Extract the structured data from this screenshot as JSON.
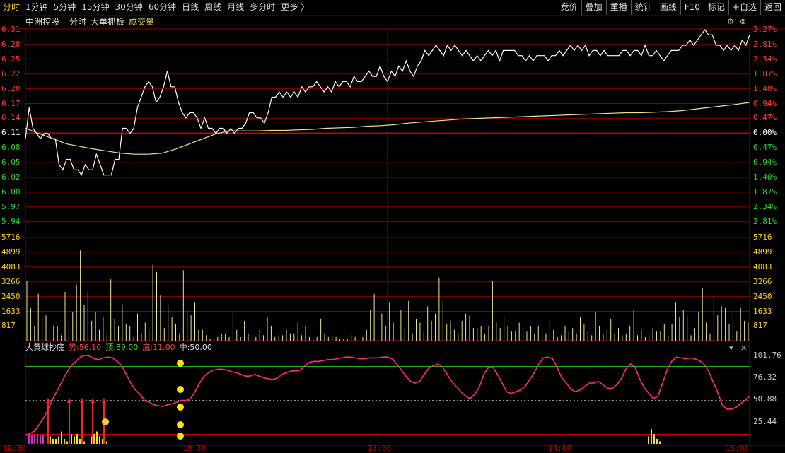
{
  "colors": {
    "background": "#000000",
    "grid": "#8b0000",
    "price_line": "#ffffff",
    "avg_line": "#e8e890",
    "up": "#ff3b3b",
    "down": "#22dd22",
    "neutral": "#ffffff",
    "volume": "#e8e890",
    "trend": "#ff2a80",
    "top_line": "#22cc22",
    "marker": "#ffe600",
    "accent": "#ffd400"
  },
  "toolbar": {
    "left_items": [
      {
        "label": "分时",
        "active": true
      },
      {
        "label": "1分钟"
      },
      {
        "label": "5分钟"
      },
      {
        "label": "15分钟"
      },
      {
        "label": "30分钟"
      },
      {
        "label": "60分钟"
      },
      {
        "label": "日线"
      },
      {
        "label": "周线"
      },
      {
        "label": "月线"
      },
      {
        "label": "多分时"
      },
      {
        "label": "更多 〉"
      }
    ],
    "right_items": [
      "竞价",
      "叠加",
      "重播",
      "统计",
      "画线",
      "F10",
      "标记",
      "+自选",
      "返回"
    ]
  },
  "header": {
    "stock_name": "中洲控股",
    "mode": "分时",
    "indicator": "大单抓板",
    "volume_label": "成交量"
  },
  "price_axis": {
    "left": [
      "6.31",
      "6.28",
      "6.25",
      "6.22",
      "6.20",
      "6.17",
      "6.14",
      "6.11",
      "6.08",
      "6.05",
      "6.02",
      "6.00",
      "5.97",
      "5.94"
    ],
    "right": [
      "3.27%",
      "2.81%",
      "2.34%",
      "1.87%",
      "1.40%",
      "0.94%",
      "0.47%",
      "0.00%",
      "0.47%",
      "0.94%",
      "1.40%",
      "1.87%",
      "2.34%",
      "2.81%"
    ],
    "right_dirs": [
      "up",
      "up",
      "up",
      "up",
      "up",
      "up",
      "up",
      "flat",
      "down",
      "down",
      "down",
      "down",
      "down",
      "down"
    ]
  },
  "volume_axis": [
    "5716",
    "4899",
    "4083",
    "3266",
    "2450",
    "1633",
    "817"
  ],
  "indicator_panel": {
    "name": "大黄球抄底",
    "shi_label": "势:",
    "shi_value": "56.10",
    "ding_label": "顶:",
    "ding_value": "89.00",
    "di_label": "底:",
    "di_value": "11.00",
    "zhong_label": "中:",
    "zhong_value": "50.00",
    "axis": [
      "101.76",
      "76.32",
      "50.88",
      "25.44"
    ]
  },
  "time_axis": [
    "09:30",
    "10:30",
    "13:00",
    "14:00",
    "15:00"
  ],
  "corner_icons": [
    "settings-icon",
    "close-icon",
    "dropdown-icon",
    "close-icon"
  ],
  "chart_data": [
    {
      "type": "line",
      "title": "中洲控股 分时",
      "ylim": [
        5.94,
        6.31
      ],
      "x_range": [
        "09:30",
        "15:00"
      ],
      "series": [
        {
          "name": "价格",
          "values": [
            6.1,
            6.16,
            6.12,
            6.11,
            6.1,
            6.11,
            6.11,
            6.1,
            6.1,
            6.05,
            6.04,
            6.06,
            6.06,
            6.04,
            6.04,
            6.03,
            6.05,
            6.04,
            6.04,
            6.07,
            6.05,
            6.03,
            6.03,
            6.03,
            6.06,
            6.06,
            6.12,
            6.12,
            6.11,
            6.12,
            6.16,
            6.18,
            6.2,
            6.21,
            6.2,
            6.17,
            6.18,
            6.2,
            6.23,
            6.2,
            6.2,
            6.17,
            6.15,
            6.14,
            6.15,
            6.15,
            6.14,
            6.12,
            6.14,
            6.12,
            6.12,
            6.11,
            6.12,
            6.12,
            6.11,
            6.12,
            6.11,
            6.12,
            6.12,
            6.13,
            6.15,
            6.15,
            6.14,
            6.14,
            6.13,
            6.15,
            6.18,
            6.18,
            6.19,
            6.18,
            6.19,
            6.18,
            6.19,
            6.18,
            6.2,
            6.19,
            6.2,
            6.2,
            6.21,
            6.2,
            6.19,
            6.2,
            6.19,
            6.21,
            6.2,
            6.21,
            6.21,
            6.2,
            6.22,
            6.21,
            6.21,
            6.22,
            6.23,
            6.22,
            6.22,
            6.24,
            6.22,
            6.21,
            6.23,
            6.22,
            6.24,
            6.23,
            6.25,
            6.23,
            6.22,
            6.24,
            6.25,
            6.27,
            6.26,
            6.27,
            6.28,
            6.27,
            6.26,
            6.28,
            6.27,
            6.28,
            6.27,
            6.26,
            6.27,
            6.26,
            6.25,
            6.26,
            6.25,
            6.26,
            6.27,
            6.26,
            6.27,
            6.25,
            6.27,
            6.27,
            6.27,
            6.27,
            6.26,
            6.26,
            6.25,
            6.26,
            6.25,
            6.26,
            6.26,
            6.26,
            6.25,
            6.26,
            6.26,
            6.27,
            6.26,
            6.27,
            6.28,
            6.27,
            6.28,
            6.27,
            6.28,
            6.26,
            6.27,
            6.27,
            6.26,
            6.27,
            6.26,
            6.26,
            6.26,
            6.26,
            6.27,
            6.27,
            6.26,
            6.27,
            6.27,
            6.26,
            6.28,
            6.26,
            6.26,
            6.27,
            6.26,
            6.25,
            6.26,
            6.27,
            6.27,
            6.27,
            6.28,
            6.28,
            6.29,
            6.28,
            6.29,
            6.3,
            6.31,
            6.3,
            6.3,
            6.28,
            6.28,
            6.27,
            6.28,
            6.27,
            6.28,
            6.27,
            6.29,
            6.28,
            6.3
          ]
        },
        {
          "name": "均价",
          "values": [
            6.12,
            6.11,
            6.1,
            6.09,
            6.085,
            6.08,
            6.076,
            6.072,
            6.07,
            6.07,
            6.072,
            6.08,
            6.09,
            6.1,
            6.11,
            6.115,
            6.115,
            6.115,
            6.116,
            6.116,
            6.117,
            6.118,
            6.12,
            6.121,
            6.122,
            6.124,
            6.125,
            6.127,
            6.13,
            6.132,
            6.134,
            6.136,
            6.138,
            6.139,
            6.14,
            6.141,
            6.142,
            6.143,
            6.144,
            6.145,
            6.146,
            6.147,
            6.148,
            6.149,
            6.15,
            6.15,
            6.151,
            6.152,
            6.154,
            6.157,
            6.16,
            6.163,
            6.166,
            6.17
          ]
        }
      ]
    },
    {
      "type": "bar",
      "title": "成交量",
      "ylim": [
        0,
        5716
      ],
      "x_range": [
        "09:30",
        "15:00"
      ],
      "values": [
        3300,
        1800,
        800,
        2600,
        1500,
        1400,
        600,
        800,
        800,
        300,
        2700,
        1000,
        1600,
        3100,
        5000,
        2000,
        2700,
        1100,
        1600,
        600,
        1300,
        400,
        3400,
        1200,
        800,
        2000,
        900,
        800,
        200,
        1500,
        400,
        1000,
        600,
        4200,
        3800,
        2500,
        700,
        2000,
        1300,
        900,
        400,
        3900,
        1700,
        1400,
        2100,
        600,
        600,
        300,
        100,
        100,
        200,
        400,
        400,
        200,
        1600,
        600,
        200,
        1100,
        400,
        300,
        200,
        600,
        300,
        1300,
        800,
        200,
        300,
        300,
        600,
        400,
        400,
        1000,
        300,
        800,
        200,
        100,
        200,
        1200,
        400,
        200,
        300,
        200,
        100,
        100,
        100,
        300,
        200,
        500,
        200,
        600,
        1700,
        2600,
        700,
        1500,
        800,
        2100,
        1000,
        1300,
        1700,
        700,
        2200,
        400,
        1200,
        1000,
        500,
        1900,
        1100,
        1500,
        3500,
        2200,
        900,
        1100,
        600,
        400,
        1100,
        1500,
        1400,
        700,
        700,
        800,
        400,
        800,
        3300,
        1000,
        700,
        1400,
        800,
        500,
        500,
        1000,
        700,
        500,
        800,
        400,
        800,
        600,
        400,
        1200,
        600,
        200,
        300,
        800,
        500,
        700,
        400,
        1300,
        900,
        500,
        300,
        1600,
        800,
        400,
        600,
        1200,
        400,
        700,
        300,
        400,
        800,
        1700,
        300,
        600,
        200,
        400,
        700,
        500,
        500,
        900,
        300,
        900,
        2100,
        1300,
        1700,
        1400,
        300,
        700,
        1600,
        2900,
        1000,
        400,
        2600,
        1400,
        1900,
        1800,
        900,
        1500,
        500,
        1800,
        1100,
        1000
      ]
    },
    {
      "type": "line",
      "title": "大黄球抄底",
      "ylim": [
        0,
        101.76
      ],
      "series": [
        {
          "name": "势",
          "values": [
            10,
            12,
            15,
            22,
            30,
            40,
            52,
            62,
            72,
            82,
            90,
            95,
            100,
            102,
            101,
            98,
            97,
            99,
            100,
            99,
            95,
            90,
            80,
            70,
            62,
            57,
            50,
            48,
            45,
            44,
            43,
            45,
            46,
            48,
            50,
            50,
            52,
            60,
            70,
            78,
            82,
            85,
            86,
            86,
            85,
            83,
            82,
            80,
            78,
            78,
            80,
            78,
            76,
            75,
            74,
            76,
            80,
            82,
            84,
            84,
            85,
            90,
            94,
            95,
            95,
            96,
            97,
            97,
            98,
            99,
            100,
            100,
            99,
            98,
            98,
            99,
            99,
            99,
            100,
            100,
            98,
            92,
            85,
            78,
            72,
            70,
            72,
            80,
            87,
            90,
            92,
            88,
            80,
            72,
            66,
            60,
            55,
            52,
            57,
            65,
            80,
            88,
            88,
            80,
            70,
            60,
            58,
            60,
            62,
            66,
            74,
            82,
            92,
            99,
            100,
            98,
            88,
            76,
            70,
            63,
            60,
            62,
            66,
            70,
            70,
            72,
            68,
            64,
            64,
            68,
            75,
            86,
            92,
            88,
            75,
            65,
            58,
            52,
            55,
            70,
            85,
            95,
            100,
            99,
            98,
            99,
            98,
            96,
            92,
            84,
            72,
            60,
            45,
            40,
            40,
            42,
            46,
            50,
            55
          ]
        }
      ],
      "reference_lines": {
        "顶": 89.0,
        "中": 50.0,
        "底": 11.0
      }
    }
  ]
}
